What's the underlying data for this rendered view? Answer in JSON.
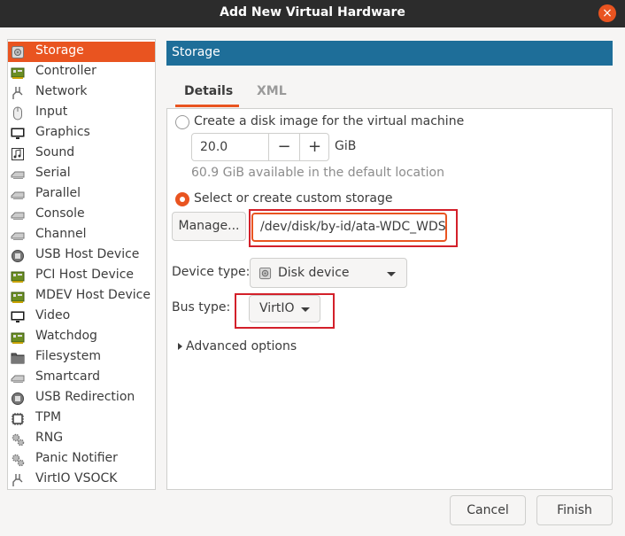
{
  "window": {
    "title": "Add New Virtual Hardware"
  },
  "sidebar": {
    "items": [
      {
        "label": "Storage",
        "icon": "disk-icon"
      },
      {
        "label": "Controller",
        "icon": "controller-icon"
      },
      {
        "label": "Network",
        "icon": "network-icon"
      },
      {
        "label": "Input",
        "icon": "mouse-icon"
      },
      {
        "label": "Graphics",
        "icon": "monitor-icon"
      },
      {
        "label": "Sound",
        "icon": "sound-icon"
      },
      {
        "label": "Serial",
        "icon": "port-icon"
      },
      {
        "label": "Parallel",
        "icon": "port-icon"
      },
      {
        "label": "Console",
        "icon": "port-icon"
      },
      {
        "label": "Channel",
        "icon": "port-icon"
      },
      {
        "label": "USB Host Device",
        "icon": "usb-icon"
      },
      {
        "label": "PCI Host Device",
        "icon": "pci-card-icon"
      },
      {
        "label": "MDEV Host Device",
        "icon": "pci-card-icon"
      },
      {
        "label": "Video",
        "icon": "monitor-icon"
      },
      {
        "label": "Watchdog",
        "icon": "pci-card-icon"
      },
      {
        "label": "Filesystem",
        "icon": "folder-icon"
      },
      {
        "label": "Smartcard",
        "icon": "port-icon"
      },
      {
        "label": "USB Redirection",
        "icon": "usb-icon"
      },
      {
        "label": "TPM",
        "icon": "chip-icon"
      },
      {
        "label": "RNG",
        "icon": "gears-icon"
      },
      {
        "label": "Panic Notifier",
        "icon": "gears-icon"
      },
      {
        "label": "VirtIO VSOCK",
        "icon": "network-icon"
      }
    ],
    "selected": "Storage"
  },
  "section_header": "Storage",
  "tabs": [
    {
      "label": "Details",
      "active": true
    },
    {
      "label": "XML",
      "active": false
    }
  ],
  "details": {
    "create_disk_label": "Create a disk image for the virtual machine",
    "size_value": "20.0",
    "minus_label": "−",
    "plus_label": "+",
    "size_unit": "GiB",
    "available_text": "60.9 GiB available in the default location",
    "custom_storage_label": "Select or create custom storage",
    "manage_label": "Manage...",
    "storage_path": "/dev/disk/by-id/ata-WDC_WDS",
    "device_type_label": "Device type:",
    "device_type_value": "Disk device",
    "bus_type_label": "Bus type:",
    "bus_type_value": "VirtIO",
    "advanced_label": "Advanced options"
  },
  "buttons": {
    "cancel": "Cancel",
    "finish": "Finish"
  },
  "colors": {
    "accent": "#e95420",
    "header": "#1e6e99",
    "titlebar": "#2c2c2c",
    "highlight_box": "#d3202a"
  }
}
